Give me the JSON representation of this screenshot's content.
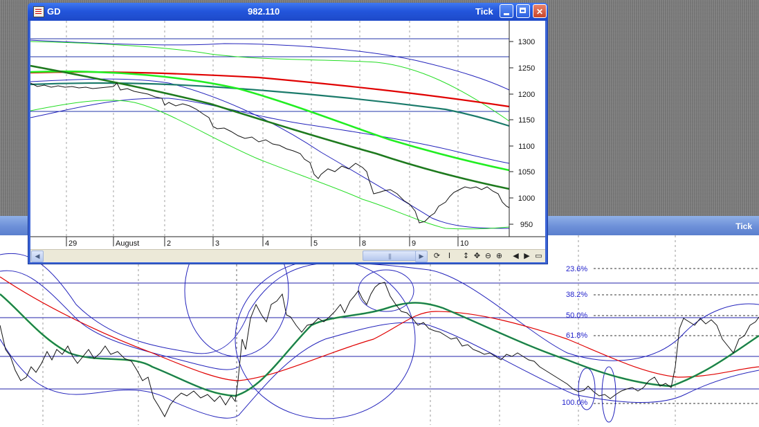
{
  "window": {
    "symbol": "GD",
    "price": "982.110",
    "mode": "Tick"
  },
  "bottom_pane": {
    "title": "Tick"
  },
  "top_chart": {
    "y_ticks": [
      "1300",
      "1250",
      "1200",
      "1150",
      "1100",
      "1050",
      "1000",
      "950"
    ],
    "x_labels": [
      "29",
      "August",
      "2",
      "3",
      "4",
      "5",
      "8",
      "9",
      "10"
    ]
  },
  "fib_levels": [
    "23.6%",
    "38.2%",
    "50.0%",
    "61.8%",
    "100.0%"
  ],
  "icons": {
    "scroll_left": "left-arrow",
    "scroll_right": "right-arrow",
    "tools": [
      "refresh-icon",
      "cursor-icon",
      "vertical-scale-icon",
      "pan-icon",
      "zoom-out-icon",
      "zoom-in-icon",
      "back-icon",
      "forward-icon",
      "panel-icon"
    ]
  },
  "colors": {
    "titlebar": "#2356dc",
    "ma_red": "#e00000",
    "ma_teal": "#1a7a6a",
    "ma_green": "#22dd22",
    "ma_darkgreen": "#1e7a1e",
    "band_blue": "#2222bb"
  }
}
